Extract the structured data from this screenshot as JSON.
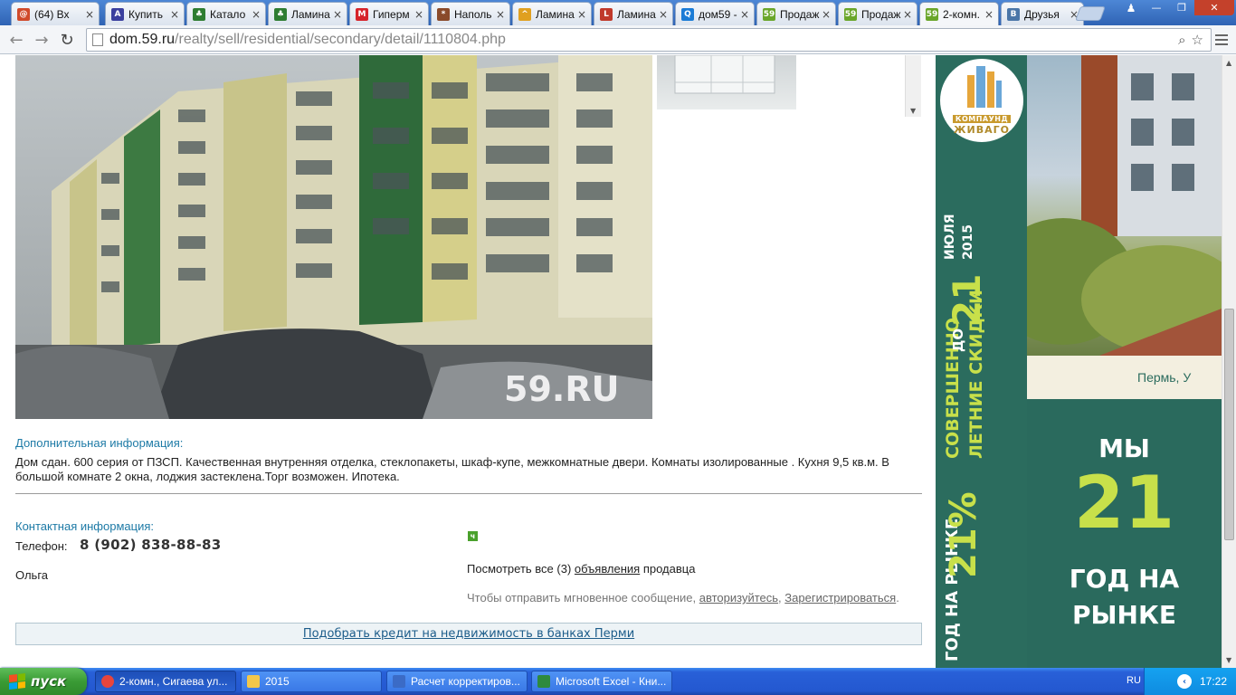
{
  "browser": {
    "tabs": [
      {
        "title": "(64) Вх",
        "icon_color": "#d04a2a",
        "icon_glyph": "@"
      },
      {
        "title": "Купить",
        "icon_color": "#3a3f9e",
        "icon_glyph": "A"
      },
      {
        "title": "Катало",
        "icon_color": "#2e7d32",
        "icon_glyph": "tree"
      },
      {
        "title": "Ламина",
        "icon_color": "#2e7d32",
        "icon_glyph": "tree"
      },
      {
        "title": "Гиперм",
        "icon_color": "#d6242b",
        "icon_glyph": "M"
      },
      {
        "title": "Наполь",
        "icon_color": "#8a4a2a",
        "icon_glyph": "*"
      },
      {
        "title": "Ламина",
        "icon_color": "#e0a020",
        "icon_glyph": "^"
      },
      {
        "title": "Ламина",
        "icon_color": "#c0392b",
        "icon_glyph": "L"
      },
      {
        "title": "дом59 -",
        "icon_color": "#1a7bd6",
        "icon_glyph": "Q"
      },
      {
        "title": "Продаж",
        "icon_color": "#6aa62a",
        "icon_glyph": "59"
      },
      {
        "title": "Продаж",
        "icon_color": "#6aa62a",
        "icon_glyph": "59"
      },
      {
        "title": "2-комн.",
        "icon_color": "#6aa62a",
        "icon_glyph": "59",
        "active": true
      },
      {
        "title": "Друзья",
        "icon_color": "#4a76a8",
        "icon_glyph": "B"
      }
    ],
    "url_host": "dom.59.ru",
    "url_path": "/realty/sell/residential/secondary/detail/1110804.php"
  },
  "photo": {
    "watermark": "59.RU"
  },
  "listing": {
    "extra_info_heading": "Дополнительная информация:",
    "extra_info_text": "Дом сдан. 600 серия от ПЗСП. Качественная внутренняя отделка, стеклопакеты, шкаф-купе, межкомнатные двери. Комнаты изолированные . Кухня 9,5 кв.м. В большой комнате 2 окна, лоджия застеклена.Торг возможен. Ипотека.",
    "contact_heading": "Контактная информация:",
    "phone_label": "Телефон:",
    "phone_number": "8 (902) 838-88-83",
    "contact_name": "Ольга",
    "icq_glyph": "ч",
    "seller_prefix": "Посмотреть все (3)",
    "seller_link": "объявления",
    "seller_suffix": "продавца",
    "msg_prefix": "Чтобы отправить мгновенное сообщение,",
    "msg_login": "авторизуйтесь",
    "msg_register": "Зарегистрироваться",
    "credit_link": "Подобрать кредит на недвижимость в банках Перми"
  },
  "banner": {
    "logo_plate": "КОМПАУНД",
    "logo_brand": "ЖИВАГО",
    "vertical_small": "ГОД НА РЫНКЕ",
    "vertical_pct": "21%",
    "vertical_line1": "СОВЕРШЕННО",
    "vertical_line2": "ЛЕТНИЕ СКИДКИ",
    "vertical_until": "ДО",
    "vertical_day": "21",
    "vertical_month": "ИЮЛЯ",
    "vertical_year": "2015",
    "city": "Пермь, У",
    "we": "МЫ",
    "years": "21",
    "year_line1": "ГОД НА",
    "year_line2": "РЫНКЕ",
    "colors": {
      "green": "#2b6c5e",
      "lime": "#c8e04a",
      "gold": "#c99a2e"
    }
  },
  "taskbar": {
    "start_label": "пуск",
    "tasks": [
      {
        "label": "2-комн., Сигаева ул...",
        "icon": "chrome",
        "active": true
      },
      {
        "label": "2015",
        "icon": "folder"
      },
      {
        "label": "Расчет корректиров...",
        "icon": "word"
      },
      {
        "label": "Microsoft Excel - Кни...",
        "icon": "excel"
      }
    ],
    "language": "RU",
    "clock": "17:22"
  }
}
